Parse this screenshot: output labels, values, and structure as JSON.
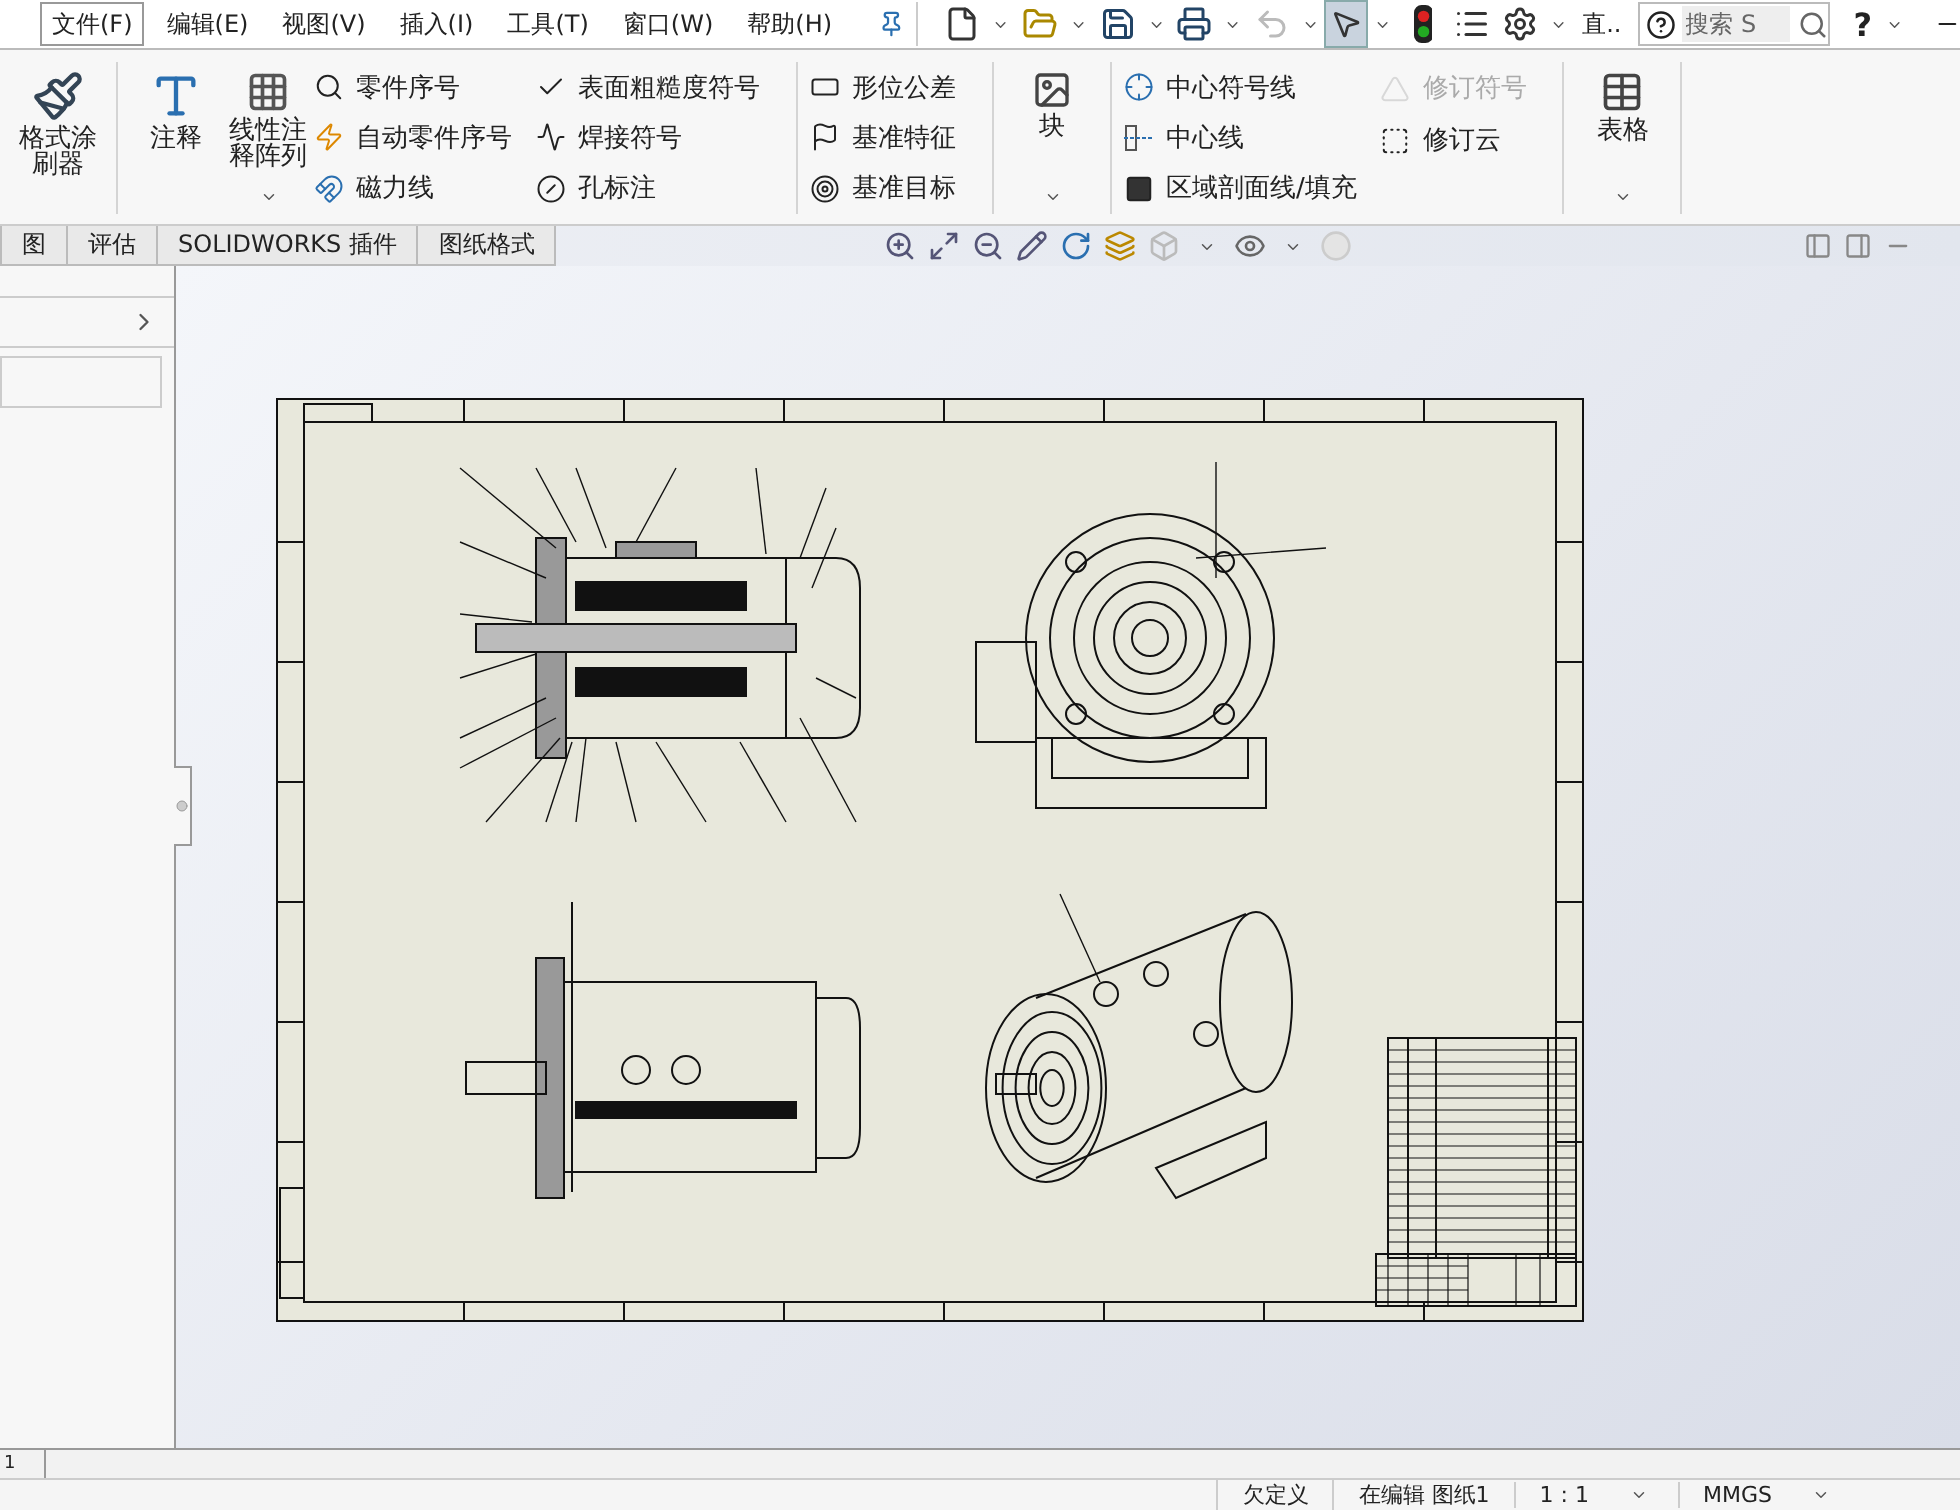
{
  "menu": [
    {
      "label": "文件(F)",
      "selected": true
    },
    {
      "label": "编辑(E)",
      "selected": false
    },
    {
      "label": "视图(V)",
      "selected": false
    },
    {
      "label": "插入(I)",
      "selected": false
    },
    {
      "label": "工具(T)",
      "selected": false
    },
    {
      "label": "窗口(W)",
      "selected": false
    },
    {
      "label": "帮助(H)",
      "selected": false
    }
  ],
  "toolbar": {
    "truncated_label": "直..",
    "help_label": "?",
    "search": {
      "placeholder": "搜索 S"
    }
  },
  "ribbon": [
    {
      "columns": [
        {
          "kind": "large",
          "label": "格式涂刷器",
          "dropdown": false
        }
      ]
    },
    {
      "columns": [
        {
          "kind": "large",
          "label": "注释",
          "dropdown": false
        },
        {
          "kind": "large",
          "label": "线性注释阵列",
          "dropdown": true
        },
        {
          "kind": "small",
          "items": [
            {
              "label": "零件序号",
              "disabled": false
            },
            {
              "label": "自动零件序号",
              "disabled": false
            },
            {
              "label": "磁力线",
              "disabled": false
            }
          ]
        },
        {
          "kind": "small",
          "items": [
            {
              "label": "表面粗糙度符号",
              "disabled": false
            },
            {
              "label": "焊接符号",
              "disabled": false
            },
            {
              "label": "孔标注",
              "disabled": false
            }
          ]
        }
      ]
    },
    {
      "columns": [
        {
          "kind": "small",
          "items": [
            {
              "label": "形位公差",
              "disabled": false
            },
            {
              "label": "基准特征",
              "disabled": false
            },
            {
              "label": "基准目标",
              "disabled": false
            }
          ]
        }
      ]
    },
    {
      "columns": [
        {
          "kind": "large",
          "label": "块",
          "dropdown": true
        }
      ]
    },
    {
      "columns": [
        {
          "kind": "small",
          "items": [
            {
              "label": "中心符号线",
              "disabled": false
            },
            {
              "label": "中心线",
              "disabled": false
            },
            {
              "label": "区域剖面线/填充",
              "disabled": false
            }
          ]
        },
        {
          "kind": "small",
          "items": [
            {
              "label": "修订符号",
              "disabled": true
            },
            {
              "label": "修订云",
              "disabled": false
            }
          ]
        }
      ]
    },
    {
      "columns": [
        {
          "kind": "large",
          "label": "表格",
          "dropdown": true
        }
      ]
    }
  ],
  "tabs": [
    {
      "label": "图",
      "selected": false
    },
    {
      "label": "评估",
      "selected": false
    },
    {
      "label": "SOLIDWORKS 插件",
      "selected": false
    },
    {
      "label": "图纸格式",
      "selected": false
    }
  ],
  "sheet_tab": {
    "label": "1"
  },
  "status_bar": [
    {
      "label": "欠定义",
      "dropdown": false
    },
    {
      "label": "在编辑 图纸1",
      "dropdown": false
    },
    {
      "label": "1 : 1",
      "dropdown": true
    },
    {
      "label": "MMGS",
      "dropdown": true
    }
  ]
}
